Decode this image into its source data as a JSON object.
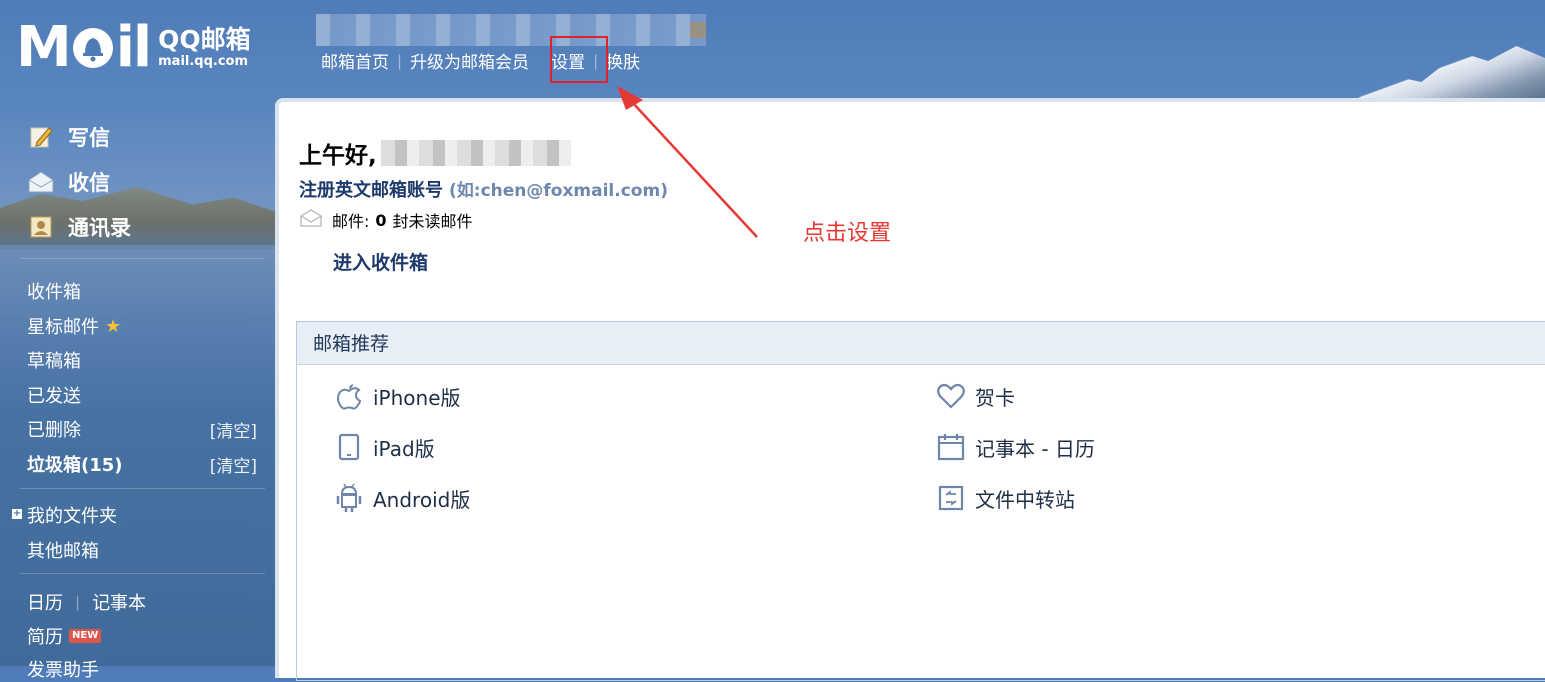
{
  "brand": {
    "logo_main": "M",
    "logo_mid": "il",
    "logo_qq": "QQ邮箱",
    "logo_url": "mail.qq.com"
  },
  "topnav": {
    "items": [
      "邮箱首页",
      "升级为邮箱会员",
      "设置",
      "换肤"
    ]
  },
  "sidebar": {
    "main": [
      {
        "label": "写信",
        "icon": "pencil-note-icon"
      },
      {
        "label": "收信",
        "icon": "envelope-open-icon"
      },
      {
        "label": "通讯录",
        "icon": "contact-card-icon"
      }
    ],
    "folders": [
      {
        "label": "收件箱"
      },
      {
        "label": "星标邮件"
      },
      {
        "label": "草稿箱"
      },
      {
        "label": "已发送"
      },
      {
        "label": "已删除",
        "action": "[清空]"
      },
      {
        "label": "垃圾箱(15)",
        "action": "[清空]"
      }
    ],
    "my_folders": "我的文件夹",
    "other_mailboxes": "其他邮箱",
    "calendar": "日历",
    "notepad": "记事本",
    "resume": "简历",
    "new_badge": "NEW",
    "bottom_partial": "发票助手"
  },
  "main": {
    "greeting": "上午好,",
    "register_link": "注册英文邮箱账号",
    "register_hint": "(如:chen@foxmail.com)",
    "mail_label": "邮件:",
    "unread_count": "0",
    "unread_suffix": "封未读邮件",
    "enter_inbox": "进入收件箱"
  },
  "recommend": {
    "title": "邮箱推荐",
    "left": [
      {
        "label": "iPhone版",
        "icon": "apple-icon"
      },
      {
        "label": "iPad版",
        "icon": "tablet-icon"
      },
      {
        "label": "Android版",
        "icon": "android-icon"
      }
    ],
    "right": [
      {
        "label": "贺卡",
        "icon": "heart-icon"
      },
      {
        "label": "记事本 - 日历",
        "icon": "calendar-icon"
      },
      {
        "label": "文件中转站",
        "icon": "transfer-box-icon"
      }
    ]
  },
  "annotation": {
    "text": "点击设置",
    "color": "#e53935"
  },
  "colors": {
    "accent_blue": "#4a76aa",
    "link_dark": "#1e3a6d",
    "highlight_red": "#e0232b"
  }
}
